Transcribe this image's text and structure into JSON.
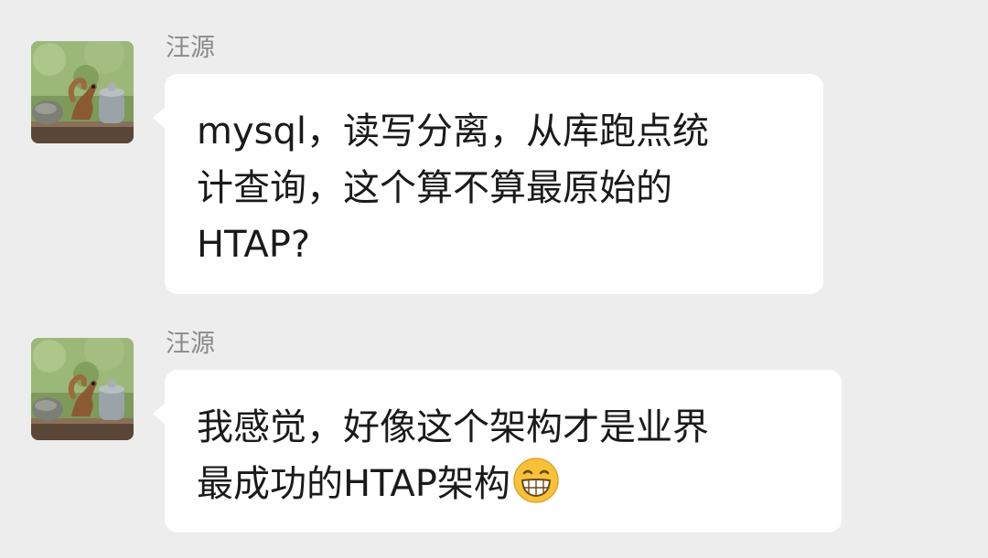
{
  "messages": [
    {
      "sender": "汪源",
      "avatar_icon": "squirrel-photo-avatar",
      "lines": [
        "mysql，读写分离，从库跑点统",
        "计查询，这个算不算最原始的",
        "HTAP?"
      ]
    },
    {
      "sender": "汪源",
      "avatar_icon": "squirrel-photo-avatar",
      "lines": [
        "我感觉，好像这个架构才是业界",
        "最成功的HTAP架构"
      ],
      "emoji_icon": "grinning-face-icon"
    }
  ],
  "colors": {
    "background": "#ededed",
    "bubble": "#ffffff",
    "sender_name": "#8a8a8a",
    "text": "#1a1a1a"
  }
}
